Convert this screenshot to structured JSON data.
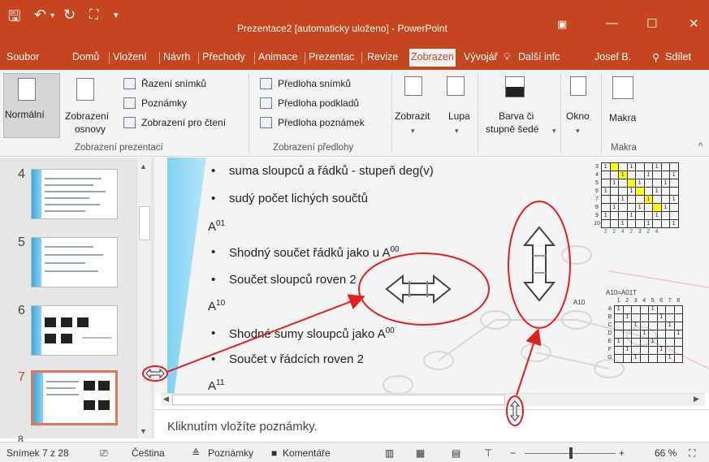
{
  "window": {
    "title": "Prezentace2 [automaticky uloženo] - PowerPoint",
    "controls": [
      "ribbon-display-icon",
      "minimize-icon",
      "maximize-icon",
      "close-icon"
    ]
  },
  "quick_access": [
    "save-icon",
    "undo-icon",
    "redo-icon",
    "start-from-beginning-icon",
    "customize-icon"
  ],
  "tabs": [
    {
      "label": "Soubor"
    },
    {
      "label": "Domů"
    },
    {
      "label": "Vložení"
    },
    {
      "label": "Návrh"
    },
    {
      "label": "Přechody"
    },
    {
      "label": "Animace"
    },
    {
      "label": "Prezentac"
    },
    {
      "label": "Revize"
    },
    {
      "label": "Zobrazen",
      "active": true
    },
    {
      "label": "Vývojář"
    },
    {
      "label": "Další infc"
    },
    {
      "label": "Josef B."
    },
    {
      "label": "Sdílet"
    }
  ],
  "ribbon": {
    "normal": "Normální",
    "outline_1": "Zobrazení",
    "outline_2": "osnovy",
    "slide_sorter": "Řazení snímků",
    "notes_page": "Poznámky",
    "reading_view": "Zobrazení pro čtení",
    "group_presentation_views": "Zobrazení prezentací",
    "slide_master": "Předloha snímků",
    "handout_master": "Předloha podkladů",
    "notes_master": "Předloha poznámek",
    "group_master_views": "Zobrazení předlohy",
    "show": "Zobrazit",
    "zoom": "Lupa",
    "color_1": "Barva či",
    "color_2": "stupně šedé",
    "window": "Okno",
    "macros": "Makra",
    "group_macros": "Makra"
  },
  "thumbnails": {
    "numbers": [
      "4",
      "5",
      "6",
      "7",
      "8"
    ],
    "active": "7"
  },
  "slide": {
    "bullets": [
      "suma sloupců a řádků - stupeň deg(v)",
      "sudý počet lichých součtů",
      "Shodný součet řádků jako u A",
      "Součet sloupců roven 2",
      "Shodné sumy sloupců jako A",
      "Součet v řádcích roven 2"
    ],
    "sup_00": "00",
    "sup_01": "01",
    "sup_10": "10",
    "sup_11": "11",
    "heading_a": "A",
    "grid_caption": "A10=A01T",
    "grid_row_label": "A10",
    "top_grid_bottom_row": [
      "2",
      "2",
      "4",
      "2",
      "3",
      "2",
      "4"
    ],
    "bottom_grid_header": [
      "1",
      "2",
      "3",
      "4",
      "5",
      "6",
      "7",
      "8"
    ],
    "bottom_grid_rows": [
      "A",
      "B",
      "C",
      "D",
      "E",
      "F",
      "G"
    ],
    "top_grid_rows": [
      "3",
      "4",
      "5",
      "6",
      "7",
      "8",
      "9",
      "10"
    ]
  },
  "notes": {
    "placeholder": "Kliknutím vložíte poznámky."
  },
  "status": {
    "slide_info": "Snímek 7 z 28",
    "language": "Čeština",
    "notes_btn": "Poznámky",
    "comments_btn": "Komentáře",
    "zoom_level": "66 %"
  },
  "colors": {
    "accent": "#c4451e",
    "highlight_yellow": "#ffff00",
    "annotation_red": "#e02020"
  }
}
